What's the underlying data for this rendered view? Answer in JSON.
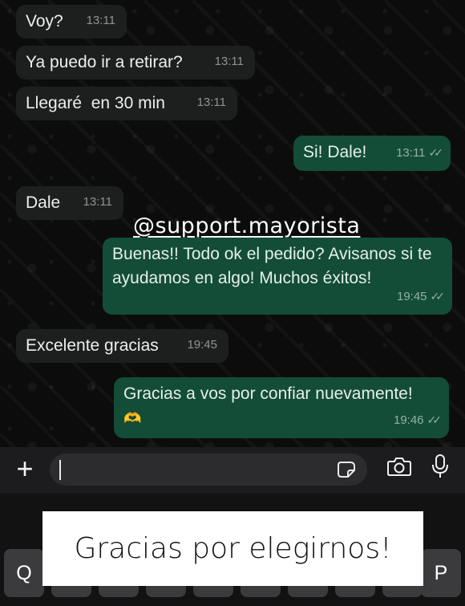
{
  "messages": [
    {
      "text": "Voy?",
      "time": "13:11"
    },
    {
      "text": "Ya puedo ir a retirar?",
      "time": "13:11"
    },
    {
      "text": "Llegaré  en 30 min",
      "time": "13:11"
    },
    {
      "text": "Si! Dale!",
      "time": "13:11",
      "ticks": "✓✓"
    },
    {
      "text": "Dale",
      "time": "13:11"
    },
    {
      "text": "Buenas!! Todo ok el pedido? Avisanos si te ayudamos en algo! Muchos éxitos!",
      "time": "19:45",
      "ticks": "✓✓"
    },
    {
      "text": "Excelente gracias",
      "time": "19:45"
    },
    {
      "text": "Gracias a vos por confiar nuevamente!",
      "emoji": "🫶",
      "time": "19:46",
      "ticks": "✓✓"
    }
  ],
  "watermark": "@support.mayorista",
  "input_bar": {
    "plus_icon": "+",
    "value": ""
  },
  "keyboard": {
    "key_left": "Q",
    "key_right": "P"
  },
  "caption": "Gracias por elegirnos!",
  "colors": {
    "incoming_bubble": "#1d1f1f",
    "outgoing_bubble": "#134d37",
    "background": "#0c0c0c"
  }
}
